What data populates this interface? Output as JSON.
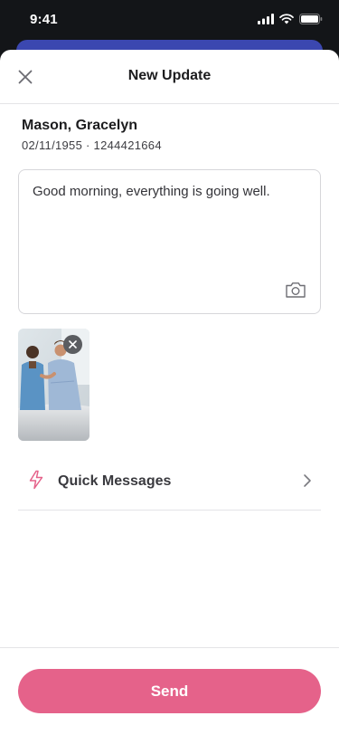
{
  "status_bar": {
    "time": "9:41"
  },
  "header": {
    "title": "New Update",
    "close_icon": "close-icon"
  },
  "patient": {
    "name": "Mason, Gracelyn",
    "meta": "02/11/1955 · 1244421664"
  },
  "composer": {
    "message": "Good morning, everything is going well.",
    "camera_icon": "camera-icon"
  },
  "attachment": {
    "remove_icon": "close-icon"
  },
  "quick_messages": {
    "label": "Quick Messages",
    "icon": "lightning-icon",
    "chevron": "chevron-right-icon"
  },
  "footer": {
    "send_label": "Send"
  },
  "colors": {
    "accent": "#e5628a",
    "behind_sheet": "#3b47b0",
    "status_bar_bg": "#131518"
  }
}
